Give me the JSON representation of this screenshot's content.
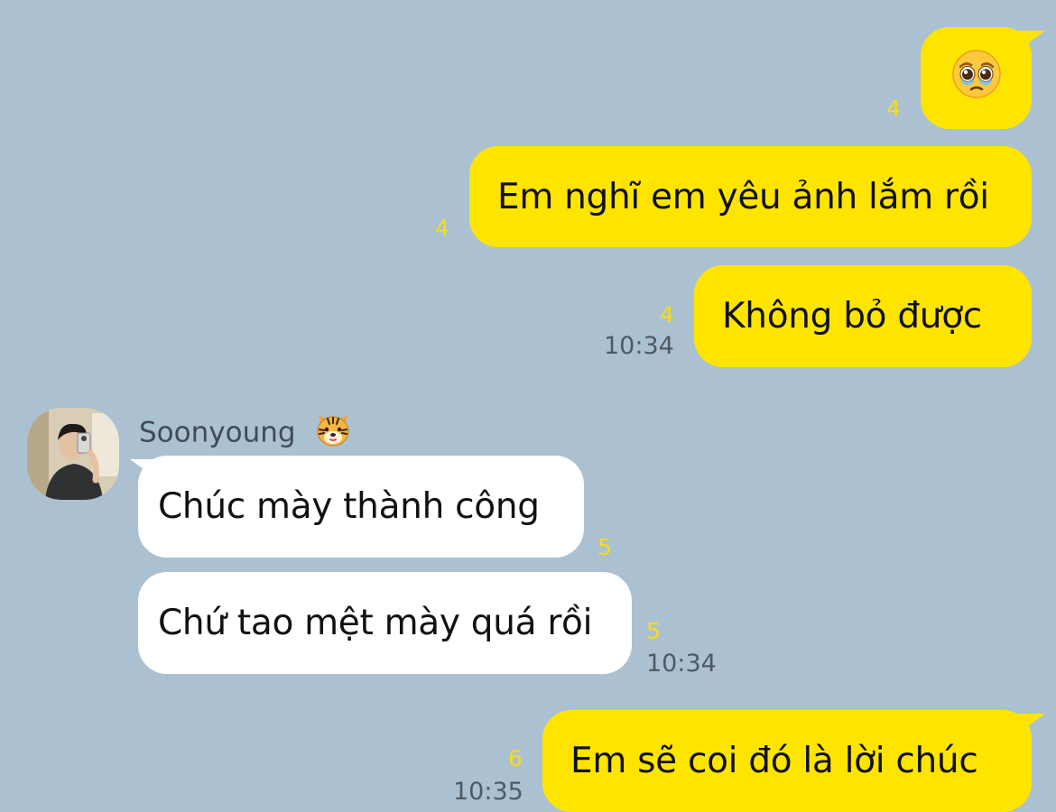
{
  "chat": {
    "messages": [
      {
        "id": "m1",
        "from": "me",
        "emoji": "pleading-face",
        "read_count": "4"
      },
      {
        "id": "m2",
        "from": "me",
        "text": "Em nghĩ em yêu ảnh lắm rồi",
        "read_count": "4"
      },
      {
        "id": "m3",
        "from": "me",
        "text": "Không bỏ được",
        "read_count": "4",
        "time": "10:34"
      },
      {
        "id": "m4",
        "from": "them",
        "text": "Chúc mày thành công",
        "read_count": "5"
      },
      {
        "id": "m5",
        "from": "them",
        "text": "Chứ tao mệt mày quá rồi",
        "read_count": "5",
        "time": "10:34"
      },
      {
        "id": "m6",
        "from": "me",
        "text": "Em sẽ coi đó là lời chúc",
        "read_count": "6",
        "time": "10:35"
      }
    ],
    "sender": {
      "name": "Soonyoung",
      "name_emoji": "tiger-face",
      "avatar_icon": "profile-photo"
    }
  },
  "colors": {
    "background": "#abc1d1",
    "my_bubble": "#fee500",
    "their_bubble": "#ffffff",
    "read_count": "#f5dd1a",
    "timestamp": "#505a64"
  }
}
